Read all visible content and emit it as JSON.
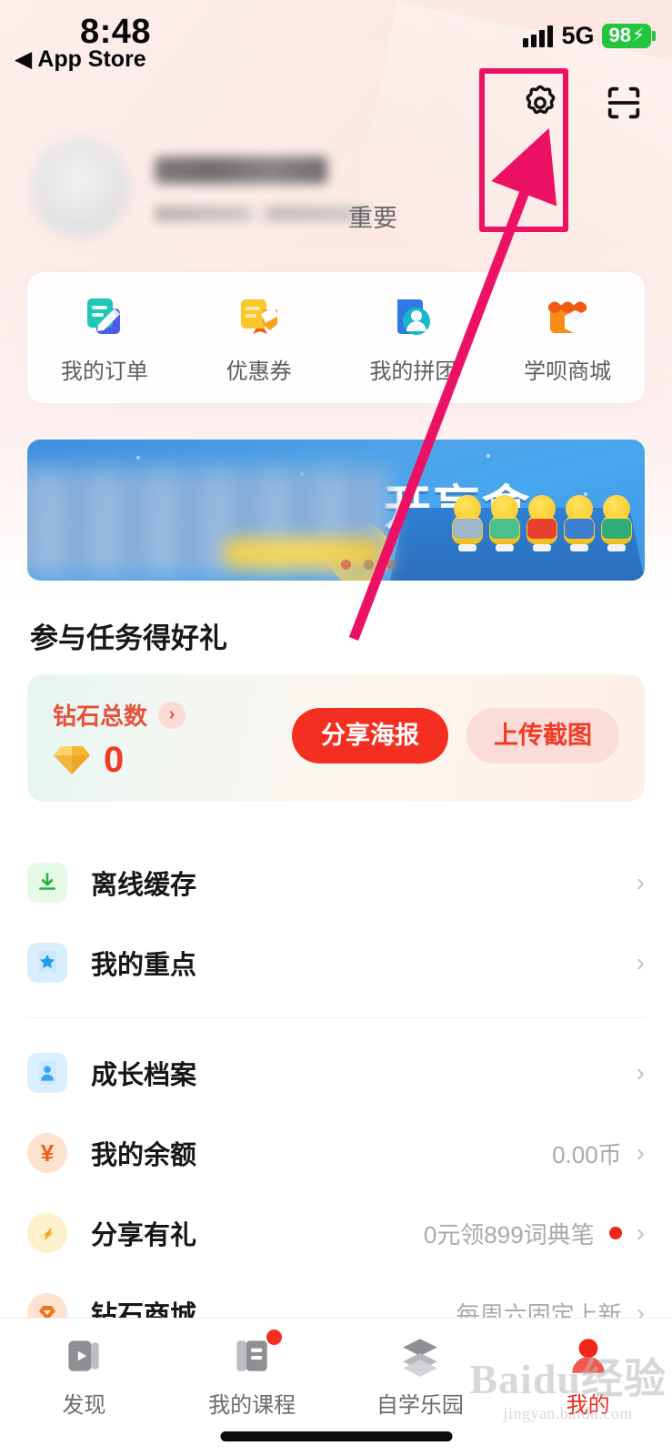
{
  "status_bar": {
    "time": "8:48",
    "back_label": "App Store",
    "network": "5G",
    "battery": "98",
    "battery_charging_glyph": "⚡",
    "signal_icon": "signal-bars-icon"
  },
  "header": {
    "settings_icon": "gear-icon",
    "scan_icon": "scan-qr-icon"
  },
  "profile": {
    "avatar_icon": "avatar",
    "name": "",
    "subtitle": "",
    "badge_label": "重要"
  },
  "quick_actions": [
    {
      "label": "我的订单",
      "icon": "order-document-icon"
    },
    {
      "label": "优惠券",
      "icon": "coupon-icon"
    },
    {
      "label": "我的拼团",
      "icon": "group-buy-person-icon"
    },
    {
      "label": "学呗商城",
      "icon": "shop-store-icon"
    }
  ],
  "banner": {
    "title_fragment": "开盲盒",
    "dots_count": 3,
    "active_dot": 0
  },
  "task_section": {
    "title": "参与任务得好礼",
    "diamond_label": "钻石总数",
    "diamond_chevron": "›",
    "diamond_icon": "diamond-icon",
    "diamond_count": "0",
    "share_poster_button": "分享海报",
    "upload_screenshot_button": "上传截图"
  },
  "list": {
    "group_one": [
      {
        "label": "离线缓存",
        "icon": "download-icon",
        "value": "",
        "badge": false
      },
      {
        "label": "我的重点",
        "icon": "star-bookmark-icon",
        "value": "",
        "badge": false
      }
    ],
    "group_two": [
      {
        "label": "成长档案",
        "icon": "profile-card-icon",
        "value": "",
        "badge": false
      },
      {
        "label": "我的余额",
        "icon": "yuan-currency-icon",
        "value": "0.00币",
        "badge": false
      },
      {
        "label": "分享有礼",
        "icon": "share-arrow-icon",
        "value": "0元领899词典笔",
        "badge": true
      },
      {
        "label": "钻石商城",
        "icon": "diamond-shop-icon",
        "value": "每周六固定上新",
        "badge": false
      }
    ],
    "chevron": "›"
  },
  "tabbar": [
    {
      "label": "发现",
      "icon": "discover-play-icon",
      "active": false,
      "badge": false
    },
    {
      "label": "我的课程",
      "icon": "my-courses-book-icon",
      "active": false,
      "badge": true
    },
    {
      "label": "自学乐园",
      "icon": "self-study-layers-icon",
      "active": false,
      "badge": false
    },
    {
      "label": "我的",
      "icon": "profile-person-icon",
      "active": true,
      "badge": false
    }
  ],
  "annotation": {
    "highlight_target": "gear-icon",
    "box_color": "#ed1164",
    "arrow_color": "#ed1164"
  },
  "watermark": {
    "main": "Baidu经验",
    "sub": "jingyan.baidu.com"
  },
  "colors": {
    "accent_red": "#f42e20",
    "bg_pink": "#fce9e5",
    "annotation_pink": "#ed1164",
    "battery_green": "#21c63c"
  }
}
